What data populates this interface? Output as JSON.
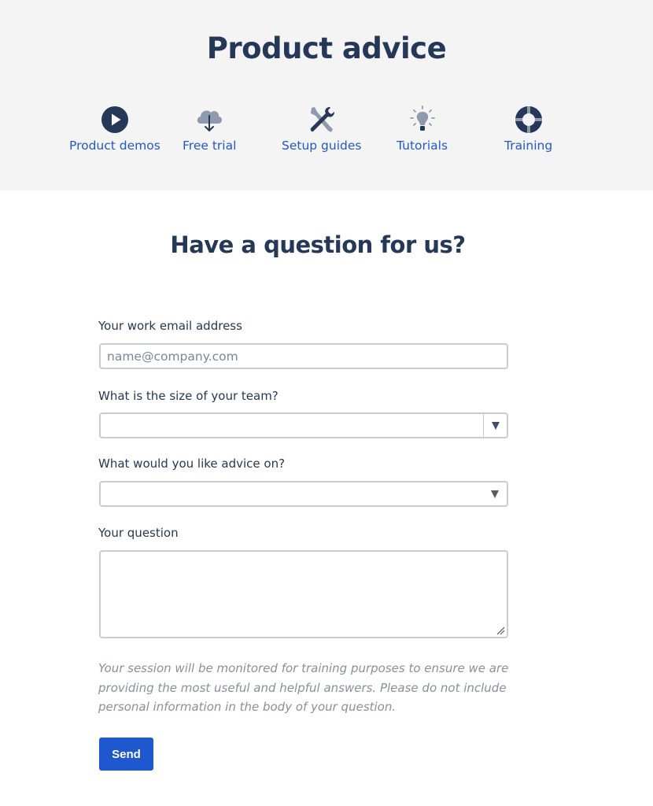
{
  "hero": {
    "title": "Product advice",
    "nav": [
      {
        "label": "Product demos",
        "icon": "play-circle-icon"
      },
      {
        "label": "Free trial",
        "icon": "cloud-download-icon"
      },
      {
        "label": "Setup guides",
        "icon": "wrench-screwdriver-icon"
      },
      {
        "label": "Tutorials",
        "icon": "lightbulb-icon"
      },
      {
        "label": "Training",
        "icon": "lifebuoy-icon"
      }
    ]
  },
  "form": {
    "title": "Have a question for us?",
    "email": {
      "label": "Your work email address",
      "placeholder": "name@company.com",
      "value": ""
    },
    "team_size": {
      "label": "What is the size of your team?",
      "selected": ""
    },
    "advice_on": {
      "label": "What would you like advice on?",
      "selected": ""
    },
    "question": {
      "label": "Your question",
      "value": ""
    },
    "disclaimer": "Your session will be monitored for training purposes to ensure we are providing the most useful and helpful answers. Please do not include personal information in the body of your question.",
    "send_label": "Send"
  },
  "colors": {
    "brand_navy": "#253858",
    "link_blue": "#2258cc",
    "button_blue": "#1f57cf",
    "hero_bg": "#f4f4f4"
  }
}
